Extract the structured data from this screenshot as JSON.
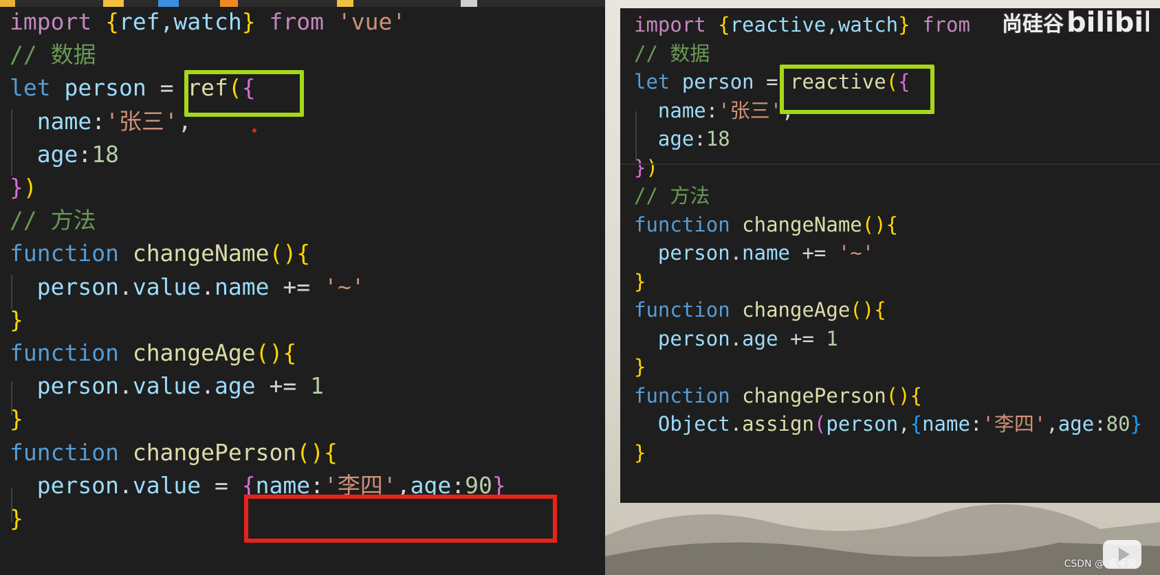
{
  "left_code": {
    "lines": [
      [
        {
          "t": "import",
          "c": "kw-import"
        },
        {
          "t": " ",
          "c": "plain"
        },
        {
          "t": "{",
          "c": "br1"
        },
        {
          "t": "ref,watch",
          "c": "id"
        },
        {
          "t": "}",
          "c": "br1"
        },
        {
          "t": " from ",
          "c": "kw-import"
        },
        {
          "t": "'vue'",
          "c": "str"
        }
      ],
      [
        {
          "t": "// 数据",
          "c": "cmt"
        }
      ],
      [
        {
          "t": "let",
          "c": "kw"
        },
        {
          "t": " person ",
          "c": "id"
        },
        {
          "t": "= ",
          "c": "plain"
        },
        {
          "t": "ref",
          "c": "fn"
        },
        {
          "t": "(",
          "c": "br1"
        },
        {
          "t": "{",
          "c": "br2"
        }
      ],
      [
        {
          "t": "  name",
          "c": "id"
        },
        {
          "t": ":",
          "c": "plain"
        },
        {
          "t": "'张三'",
          "c": "str"
        },
        {
          "t": ",",
          "c": "plain"
        }
      ],
      [
        {
          "t": "  age",
          "c": "id"
        },
        {
          "t": ":",
          "c": "plain"
        },
        {
          "t": "18",
          "c": "num"
        }
      ],
      [
        {
          "t": "}",
          "c": "br2"
        },
        {
          "t": ")",
          "c": "br1"
        }
      ],
      [
        {
          "t": "// 方法",
          "c": "cmt"
        }
      ],
      [
        {
          "t": "function",
          "c": "kw"
        },
        {
          "t": " changeName",
          "c": "fn"
        },
        {
          "t": "()",
          "c": "br1"
        },
        {
          "t": "{",
          "c": "br1"
        }
      ],
      [
        {
          "t": "  person",
          "c": "id"
        },
        {
          "t": ".",
          "c": "plain"
        },
        {
          "t": "value",
          "c": "id"
        },
        {
          "t": ".",
          "c": "plain"
        },
        {
          "t": "name",
          "c": "id"
        },
        {
          "t": " += ",
          "c": "plain"
        },
        {
          "t": "'~'",
          "c": "str"
        }
      ],
      [
        {
          "t": "}",
          "c": "br1"
        }
      ],
      [
        {
          "t": "function",
          "c": "kw"
        },
        {
          "t": " changeAge",
          "c": "fn"
        },
        {
          "t": "()",
          "c": "br1"
        },
        {
          "t": "{",
          "c": "br1"
        }
      ],
      [
        {
          "t": "  person",
          "c": "id"
        },
        {
          "t": ".",
          "c": "plain"
        },
        {
          "t": "value",
          "c": "id"
        },
        {
          "t": ".",
          "c": "plain"
        },
        {
          "t": "age",
          "c": "id"
        },
        {
          "t": " += ",
          "c": "plain"
        },
        {
          "t": "1",
          "c": "num"
        }
      ],
      [
        {
          "t": "}",
          "c": "br1"
        }
      ],
      [
        {
          "t": "function",
          "c": "kw"
        },
        {
          "t": " changePerson",
          "c": "fn"
        },
        {
          "t": "()",
          "c": "br1"
        },
        {
          "t": "{",
          "c": "br1"
        }
      ],
      [
        {
          "t": "  person",
          "c": "id"
        },
        {
          "t": ".",
          "c": "plain"
        },
        {
          "t": "value",
          "c": "id"
        },
        {
          "t": " = ",
          "c": "plain"
        },
        {
          "t": "{",
          "c": "br2"
        },
        {
          "t": "name",
          "c": "id"
        },
        {
          "t": ":",
          "c": "plain"
        },
        {
          "t": "'李四'",
          "c": "str"
        },
        {
          "t": ",",
          "c": "plain"
        },
        {
          "t": "age",
          "c": "id"
        },
        {
          "t": ":",
          "c": "plain"
        },
        {
          "t": "90",
          "c": "num"
        },
        {
          "t": "}",
          "c": "br2"
        }
      ],
      [
        {
          "t": "}",
          "c": "br1"
        }
      ]
    ]
  },
  "right_code": {
    "lines": [
      [
        {
          "t": "import",
          "c": "kw-import"
        },
        {
          "t": " ",
          "c": "plain"
        },
        {
          "t": "{",
          "c": "br1"
        },
        {
          "t": "reactive,watch",
          "c": "id"
        },
        {
          "t": "}",
          "c": "br1"
        },
        {
          "t": " from",
          "c": "kw-import"
        }
      ],
      [
        {
          "t": "// 数据",
          "c": "cmt"
        }
      ],
      [
        {
          "t": "let",
          "c": "kw"
        },
        {
          "t": " person ",
          "c": "id"
        },
        {
          "t": "= ",
          "c": "plain"
        },
        {
          "t": "reactive",
          "c": "fn"
        },
        {
          "t": "(",
          "c": "br1"
        },
        {
          "t": "{",
          "c": "br2"
        }
      ],
      [
        {
          "t": "  name",
          "c": "id"
        },
        {
          "t": ":",
          "c": "plain"
        },
        {
          "t": "'张三'",
          "c": "str"
        },
        {
          "t": ",",
          "c": "plain"
        }
      ],
      [
        {
          "t": "  age",
          "c": "id"
        },
        {
          "t": ":",
          "c": "plain"
        },
        {
          "t": "18",
          "c": "num"
        }
      ],
      [
        {
          "t": "}",
          "c": "br2"
        },
        {
          "t": ")",
          "c": "br1"
        }
      ],
      [
        {
          "t": "// 方法",
          "c": "cmt"
        }
      ],
      [
        {
          "t": "function",
          "c": "kw"
        },
        {
          "t": " changeName",
          "c": "fn"
        },
        {
          "t": "()",
          "c": "br1"
        },
        {
          "t": "{",
          "c": "br1"
        }
      ],
      [
        {
          "t": "  person",
          "c": "id"
        },
        {
          "t": ".",
          "c": "plain"
        },
        {
          "t": "name",
          "c": "id"
        },
        {
          "t": " += ",
          "c": "plain"
        },
        {
          "t": "'~'",
          "c": "str"
        }
      ],
      [
        {
          "t": "}",
          "c": "br1"
        }
      ],
      [
        {
          "t": "function",
          "c": "kw"
        },
        {
          "t": " changeAge",
          "c": "fn"
        },
        {
          "t": "()",
          "c": "br1"
        },
        {
          "t": "{",
          "c": "br1"
        }
      ],
      [
        {
          "t": "  person",
          "c": "id"
        },
        {
          "t": ".",
          "c": "plain"
        },
        {
          "t": "age",
          "c": "id"
        },
        {
          "t": " += ",
          "c": "plain"
        },
        {
          "t": "1",
          "c": "num"
        }
      ],
      [
        {
          "t": "}",
          "c": "br1"
        }
      ],
      [
        {
          "t": "function",
          "c": "kw"
        },
        {
          "t": " changePerson",
          "c": "fn"
        },
        {
          "t": "()",
          "c": "br1"
        },
        {
          "t": "{",
          "c": "br1"
        }
      ],
      [
        {
          "t": "  Object",
          "c": "id"
        },
        {
          "t": ".",
          "c": "plain"
        },
        {
          "t": "assign",
          "c": "fn"
        },
        {
          "t": "(",
          "c": "br2"
        },
        {
          "t": "person",
          "c": "id"
        },
        {
          "t": ",",
          "c": "plain"
        },
        {
          "t": "{",
          "c": "br3"
        },
        {
          "t": "name",
          "c": "id"
        },
        {
          "t": ":",
          "c": "plain"
        },
        {
          "t": "'李四'",
          "c": "str"
        },
        {
          "t": ",",
          "c": "plain"
        },
        {
          "t": "age",
          "c": "id"
        },
        {
          "t": ":",
          "c": "plain"
        },
        {
          "t": "80",
          "c": "num"
        },
        {
          "t": "}",
          "c": "br3"
        }
      ],
      [
        {
          "t": "}",
          "c": "br1"
        }
      ]
    ]
  },
  "watermark": {
    "brand": "尚硅谷",
    "site_logo": "bilibili",
    "csdn": "CSDN @-袁平安"
  },
  "colors": {
    "highlight_green": "#a5d81a",
    "highlight_red": "#e8231a",
    "editor_bg": "#1e1e1e"
  },
  "icons": [
    "bilibili-logo-icon",
    "play-badge-icon"
  ]
}
